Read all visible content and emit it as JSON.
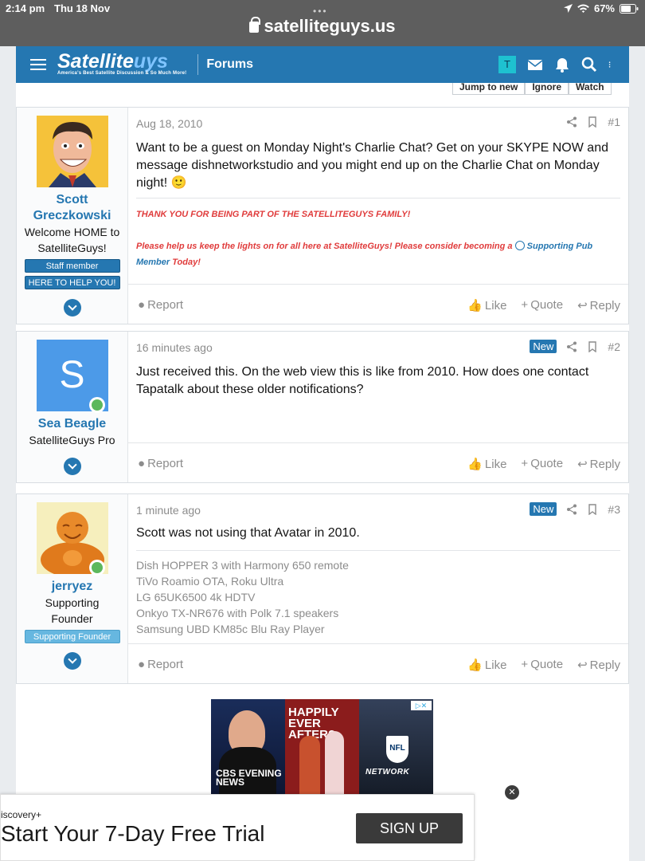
{
  "status": {
    "time": "2:14 pm",
    "date": "Thu 18 Nov",
    "battery": "67%"
  },
  "browser": {
    "url": "satelliteguys.us"
  },
  "header": {
    "logo_main": "Satellite",
    "logo_accent": "uys",
    "logo_tagline": "America's Best Satellite Discussion & So Much More!",
    "nav_label": "Forums",
    "user_initial": "T"
  },
  "thread_buttons": [
    "Jump to new",
    "Ignore",
    "Watch"
  ],
  "posts": [
    {
      "user": {
        "name": "Scott Greczkowski",
        "title": "Welcome HOME to SatelliteGuys!",
        "banners": [
          "Staff member",
          "HERE TO HELP YOU!"
        ]
      },
      "date": "Aug 18, 2010",
      "number": "#1",
      "body": "Want to be a guest on Monday Night's Charlie Chat? Get on your SKYPE NOW and message dishnetworkstudio and you might end up on the Charlie Chat on Monday night!",
      "emoji": "🙂",
      "signature": {
        "line1": "THANK YOU FOR BEING PART OF THE SATELLITEGUYS FAMILY!",
        "line2_pre": "Please help us keep the lights on for all here at SatelliteGuys! Please consider becoming a",
        "line2_link": "Supporting Pub Member",
        "line2_post": "Today!"
      }
    },
    {
      "user": {
        "name": "Sea Beagle",
        "title": "SatelliteGuys Pro",
        "initial": "S"
      },
      "date": "16 minutes ago",
      "badge": "New",
      "number": "#2",
      "body": "Just received this. On the web view this is like from 2010. How does one contact Tapatalk about these older notifications?"
    },
    {
      "user": {
        "name": "jerryez",
        "title": "Supporting Founder",
        "banners": [
          "Supporting Founder"
        ]
      },
      "date": "1 minute ago",
      "badge": "New",
      "number": "#3",
      "body": "Scott was not using that Avatar in 2010.",
      "signature_lines": [
        "Dish HOPPER 3 with Harmony 650 remote",
        "TiVo Roamio OTA, Roku Ultra",
        "LG 65UK6500 4k HDTV",
        "Onkyo TX-NR676 with Polk 7.1 speakers",
        "Samsung UBD KM85c Blu Ray Player"
      ]
    }
  ],
  "post_actions": {
    "report": "Report",
    "like": "Like",
    "quote": "Quote",
    "reply": "Reply"
  },
  "ad": {
    "cbs": "CBS EVENING NEWS",
    "show": "HAPPILY EVER AFTER?",
    "nfl": "NFL",
    "network": "NETWORK"
  },
  "bottom_ad": {
    "brand": "iscovery+",
    "headline": "Start Your 7-Day Free Trial",
    "cta": "SIGN UP",
    "close": "✕"
  }
}
